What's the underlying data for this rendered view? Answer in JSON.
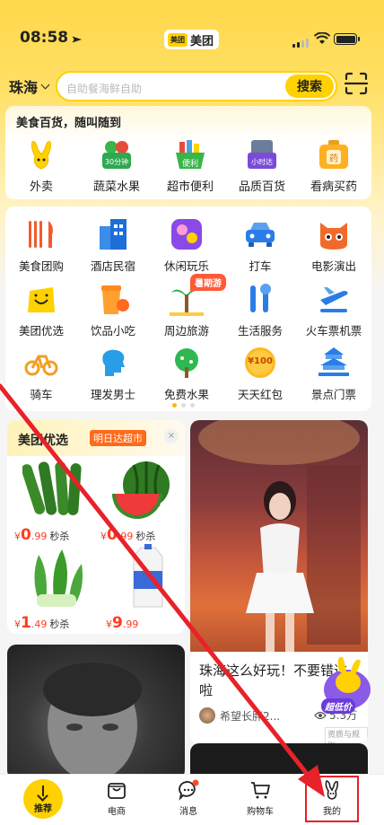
{
  "status_bar": {
    "time": "08:58",
    "brand": "美团",
    "brand_logo_text": "美团"
  },
  "search": {
    "city": "珠海",
    "placeholder": "自助餐海鲜自助",
    "button": "搜索"
  },
  "quick_access": {
    "title": "美食百货，随叫随到",
    "items": [
      {
        "label": "外卖",
        "badge": ""
      },
      {
        "label": "蔬菜水果",
        "badge": "30分钟"
      },
      {
        "label": "超市便利",
        "badge": "便利"
      },
      {
        "label": "品质百货",
        "badge": "小时达"
      },
      {
        "label": "看病买药",
        "badge": "药"
      }
    ]
  },
  "services": [
    {
      "label": "美食团购"
    },
    {
      "label": "酒店民宿"
    },
    {
      "label": "休闲玩乐"
    },
    {
      "label": "打车"
    },
    {
      "label": "电影演出"
    },
    {
      "label": "美团优选"
    },
    {
      "label": "饮品小吃"
    },
    {
      "label": "周边旅游"
    },
    {
      "label": "生活服务"
    },
    {
      "label": "火车票机票"
    },
    {
      "label": "骑车"
    },
    {
      "label": "理发男士"
    },
    {
      "label": "免费水果"
    },
    {
      "label": "天天红包"
    },
    {
      "label": "景点门票"
    }
  ],
  "summer_tag": "暑期游",
  "red_packet_amount": "¥100",
  "youxuan": {
    "title": "美团优选",
    "tag": "明日达超市",
    "close": "×",
    "products": [
      {
        "currency": "¥",
        "int": "0",
        "dec": ".99",
        "label": "秒杀"
      },
      {
        "currency": "¥",
        "int": "0",
        "dec": ".99",
        "label": "秒杀"
      },
      {
        "currency": "¥",
        "int": "1",
        "dec": ".49",
        "label": "秒杀"
      },
      {
        "currency": "¥",
        "int": "9",
        "dec": ".99",
        "label": ""
      }
    ]
  },
  "feed_post": {
    "title": "珠海这么好玩！不要错过啦",
    "author": "希望长胖2...",
    "views": "5.3万",
    "badge": "资质与规则",
    "promo": "超低价"
  },
  "tabbar": {
    "items": [
      {
        "label": "推荐"
      },
      {
        "label": "电商"
      },
      {
        "label": "消息"
      },
      {
        "label": "购物车"
      },
      {
        "label": "我的"
      }
    ]
  },
  "colors": {
    "accent": "#ffd100",
    "price": "#ff3b1f",
    "annotation": "#e8222a"
  }
}
